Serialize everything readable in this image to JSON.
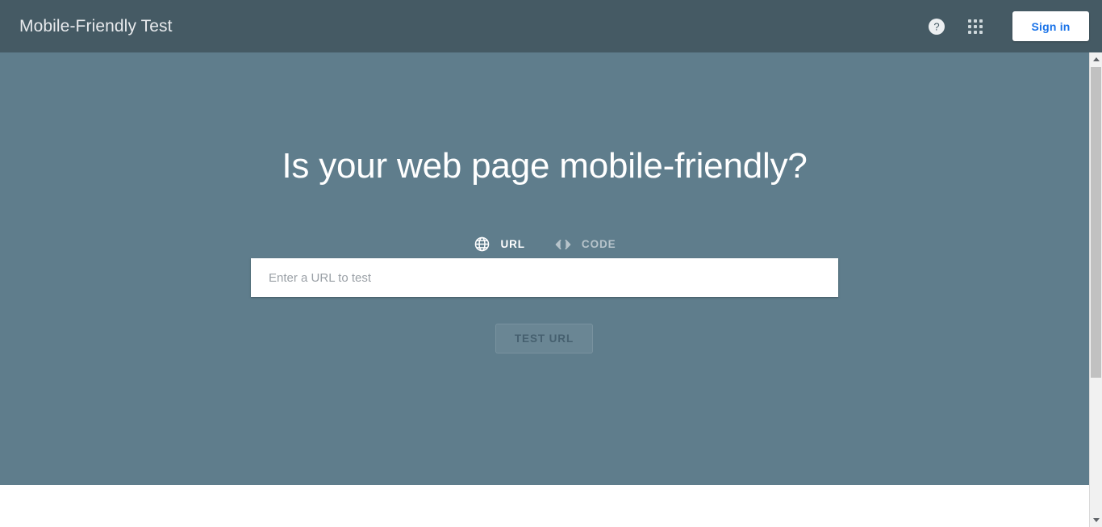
{
  "header": {
    "title": "Mobile-Friendly Test",
    "help_icon": "help-circle-icon",
    "apps_icon": "apps-grid-icon",
    "signin_label": "Sign in",
    "background_color": "#455a64",
    "signin_text_color": "#1a73e8"
  },
  "hero": {
    "title": "Is your web page mobile-friendly?",
    "background_color": "#5f7d8c",
    "accent_color": "#f5a623",
    "tabs": [
      {
        "label": "URL",
        "icon": "globe-icon",
        "active": true
      },
      {
        "label": "CODE",
        "icon": "code-brackets-icon",
        "active": false
      }
    ],
    "url_input": {
      "value": "",
      "placeholder": "Enter a URL to test"
    },
    "test_button": {
      "label": "TEST URL",
      "enabled": false
    }
  },
  "scrollbar": {
    "up_arrow": "chevron-up-icon",
    "down_arrow": "chevron-down-icon",
    "thumb_position": "top"
  }
}
